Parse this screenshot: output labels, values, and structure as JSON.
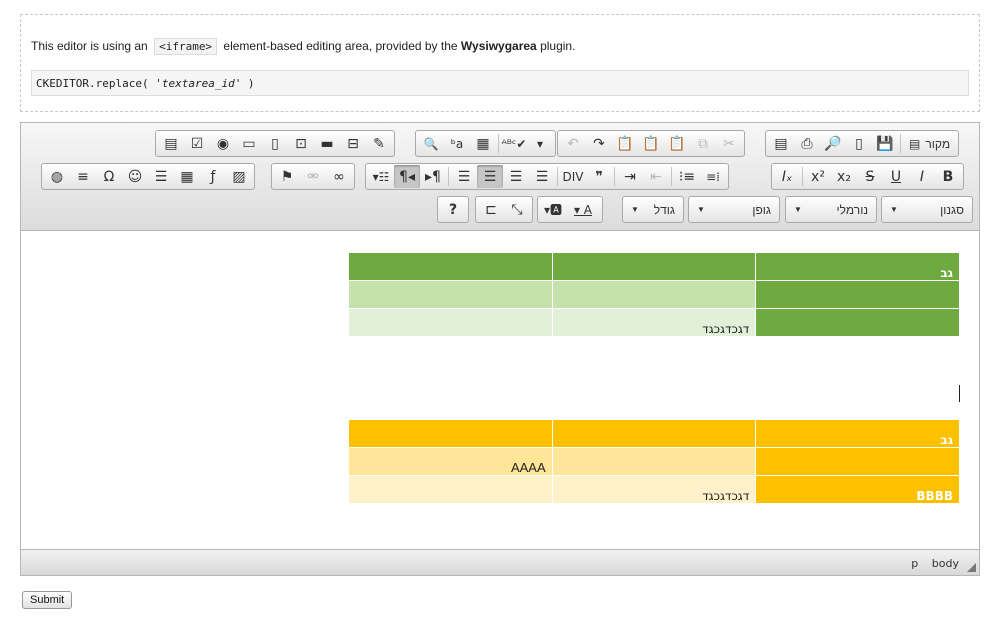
{
  "info": {
    "prefix": "This editor is using an",
    "code_tag": "<iframe>",
    "middle": "element-based editing area, provided by the",
    "plugin_name": "Wysiwygarea",
    "suffix": "plugin.",
    "code_before": "CKEDITOR.replace( ",
    "code_arg": "'textarea_id'",
    "code_after": " )"
  },
  "toolbar": {
    "source_label": "מקור",
    "styles_label": "סגנון",
    "format_label": "נורמלי",
    "font_label": "גופן",
    "size_label": "גודל",
    "icons": {
      "row1_forms": [
        "form-icon",
        "checkbox-icon",
        "radio-icon",
        "textfield-icon",
        "textarea-icon",
        "select-icon",
        "button-icon",
        "imagebutton-icon",
        "hiddenfield-icon"
      ],
      "row1_find": [
        "find-icon",
        "replace-icon",
        "selectall-icon",
        "spellcheck-icon"
      ],
      "row1_clipboard": [
        "undo-icon",
        "redo-icon",
        "paste-word-icon",
        "paste-text-icon",
        "paste-icon",
        "copy-icon",
        "cut-icon"
      ],
      "row1_doc": [
        "save-icon",
        "newpage-icon",
        "preview-icon",
        "print-icon",
        "templates-icon"
      ],
      "row2_insert": [
        "iframe-icon",
        "image-icon",
        "flash-icon",
        "table-icon",
        "hr-icon",
        "smiley-icon",
        "specialchar-icon",
        "pagebreak-icon"
      ],
      "row2_links": [
        "link-icon",
        "unlink-icon",
        "anchor-icon"
      ],
      "row2_para": [
        "bidi-ltr-icon",
        "bidi-rtl-icon",
        "language-icon",
        "justify-left-icon",
        "justify-center-icon",
        "justify-right-icon",
        "justify-block-icon",
        "blockquote-icon",
        "creatediv-icon",
        "indent-icon",
        "outdent-icon",
        "numbered-list-icon",
        "bulleted-list-icon"
      ],
      "row2_basic": [
        "removeformat-icon",
        "superscript-icon",
        "subscript-icon",
        "strike-icon",
        "underline-icon",
        "italic-icon",
        "bold-icon"
      ],
      "row3": [
        "about-icon",
        "showblocks-icon",
        "maximize-icon",
        "bgcolor-icon",
        "textcolor-icon"
      ]
    }
  },
  "content": {
    "green_table": {
      "colors": {
        "dark": "#6eaa3f",
        "mid": "#c5e2ad",
        "light": "#e2efd9"
      },
      "rows": [
        [
          "",
          "",
          "גב"
        ],
        [
          "",
          "",
          ""
        ],
        [
          "",
          "דגכדגכגד",
          ""
        ]
      ]
    },
    "orange_table": {
      "colors": {
        "dark": "#ffc000",
        "mid": "#ffe598",
        "light": "#fff2cb"
      },
      "rows": [
        [
          "",
          "",
          "גב"
        ],
        [
          "AAAA",
          "",
          ""
        ],
        [
          "",
          "דגכדגכגד",
          "BBBB"
        ]
      ]
    }
  },
  "statusbar": {
    "path": [
      "p",
      "body"
    ]
  },
  "submit_label": "Submit"
}
